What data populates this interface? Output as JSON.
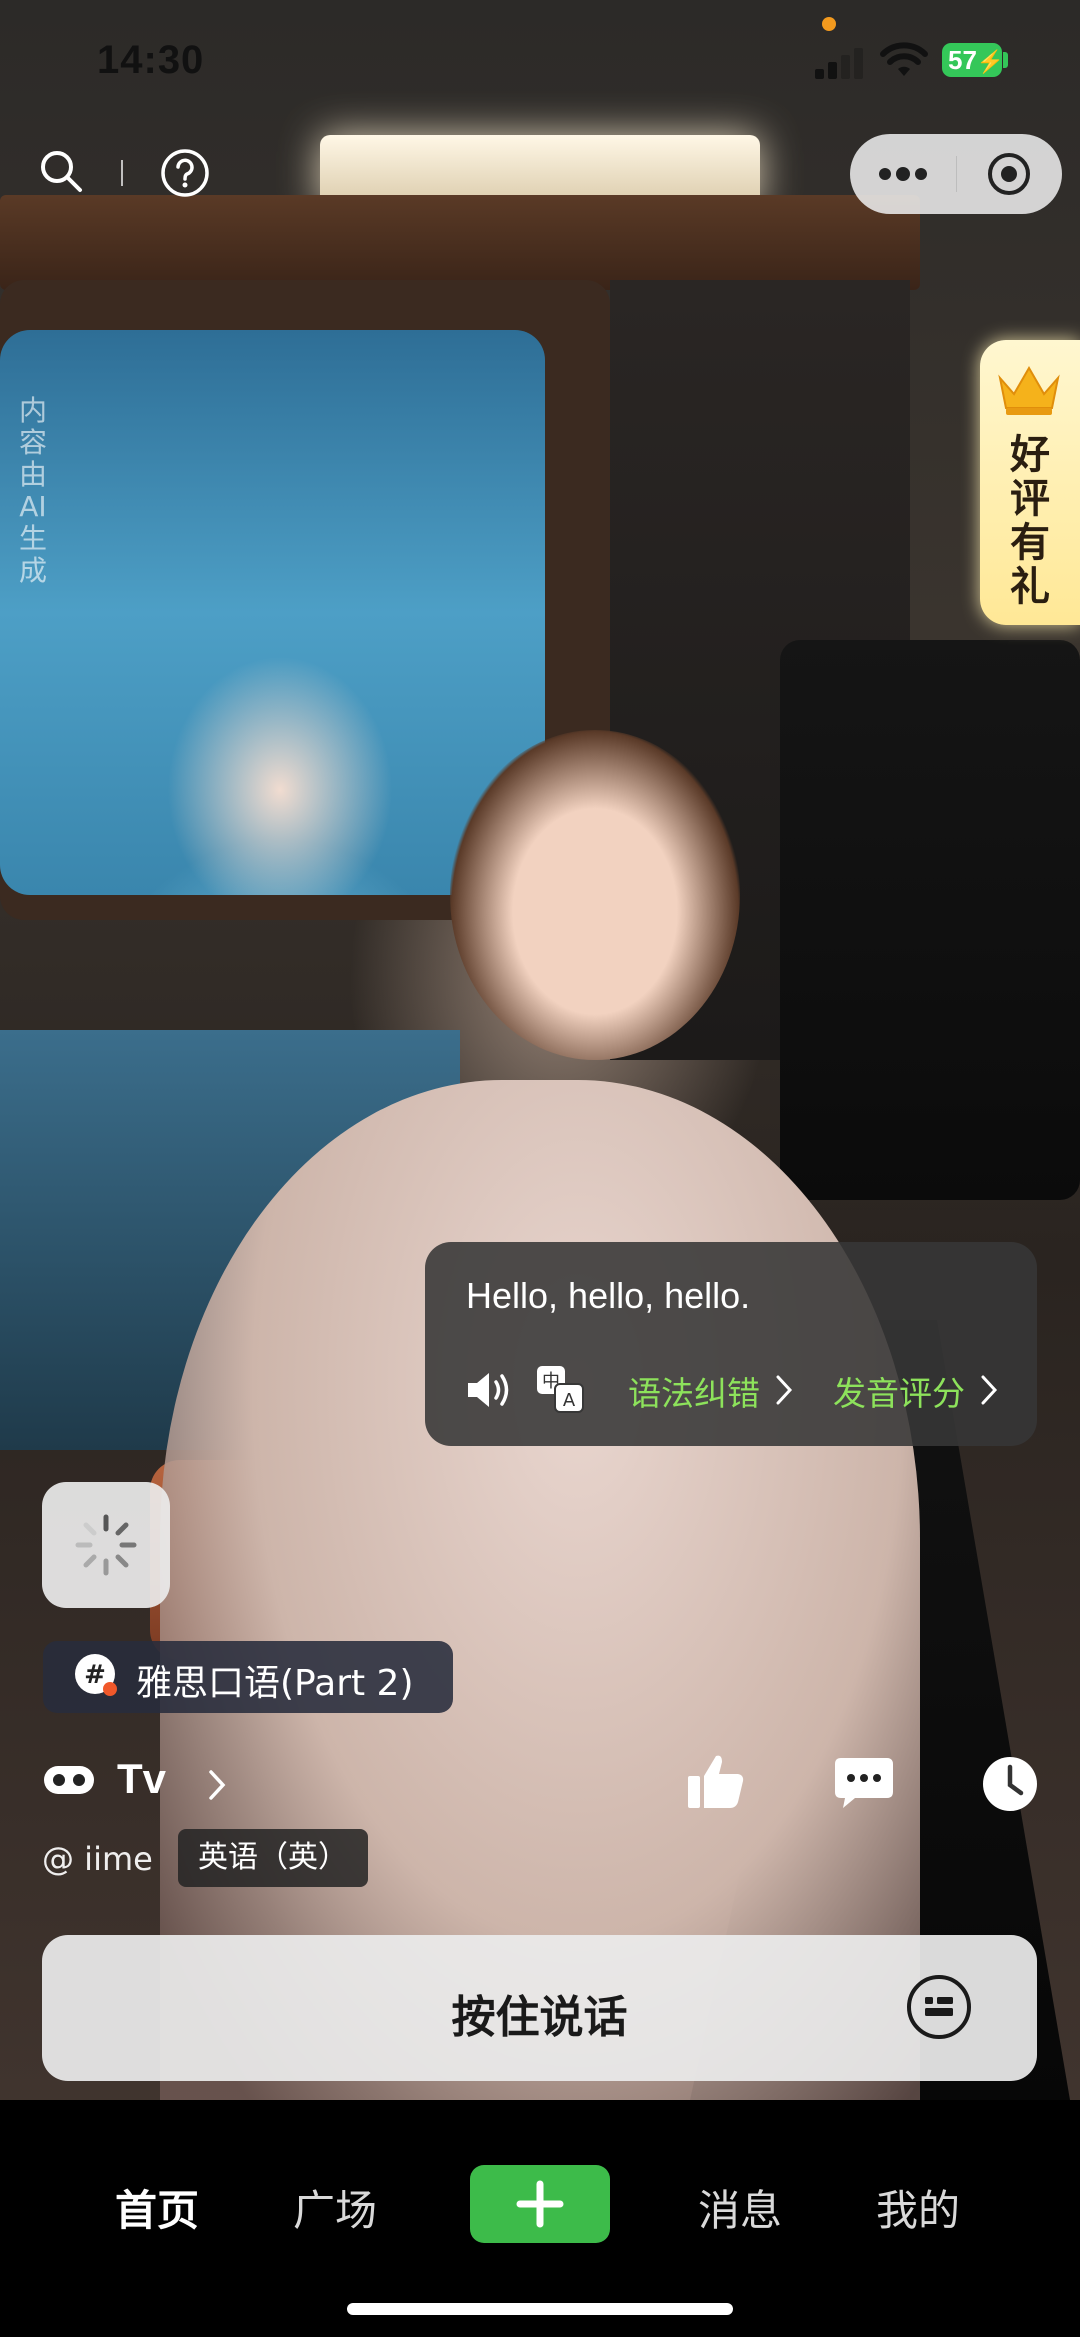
{
  "status_bar": {
    "time": "14:30",
    "battery": "57",
    "colors": {
      "battery": "#34c759",
      "recording_dot": "#f39a1e"
    }
  },
  "top_bar": {
    "icons": [
      "search-icon",
      "help-icon",
      "more-icon",
      "close-miniprogram-icon"
    ]
  },
  "ai_notice": "内容由AI生成",
  "review_badge": {
    "text": "好评有礼",
    "icon": "crown-icon"
  },
  "speech_bubble": {
    "text": "Hello, hello, hello.",
    "grammar_label": "语法纠错",
    "pronunciation_label": "发音评分",
    "accent_color": "#8de25b"
  },
  "loading_button": {
    "icon": "loading-spinner-icon"
  },
  "topic_tag": {
    "text": "雅思口语(Part 2)",
    "icon": "hashtag-icon"
  },
  "persona": {
    "name": "Tv",
    "author": "@ iime",
    "language": "英语（英）",
    "icon": "persona-mask-icon"
  },
  "actions": [
    "thumbs-up-icon",
    "chat-bubble-icon",
    "history-clock-icon"
  ],
  "talk_button": {
    "label": "按住说话",
    "icon": "keyboard-icon"
  },
  "bottom_nav": {
    "items": [
      {
        "label": "首页",
        "active": true
      },
      {
        "label": "广场",
        "active": false
      },
      {
        "label": "消息",
        "active": false
      },
      {
        "label": "我的",
        "active": false
      }
    ],
    "add_icon": "plus-icon",
    "add_color": "#3dbb4a"
  }
}
